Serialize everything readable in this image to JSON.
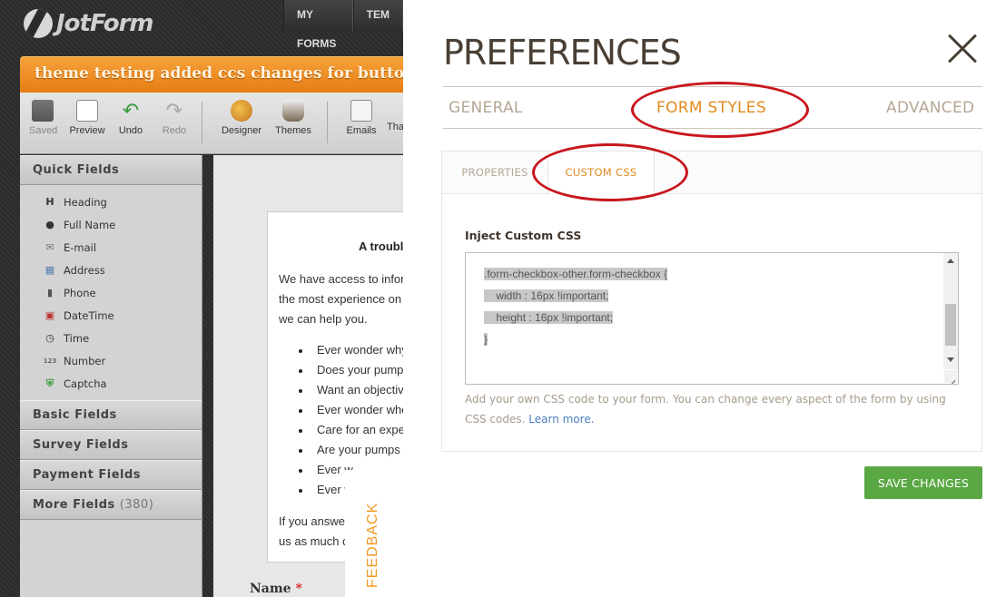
{
  "builder": {
    "logo_text": "JotForm",
    "top_nav": [
      "MY FORMS",
      "TEM"
    ],
    "form_title": "theme testing added ccs changes for buttons",
    "toolbar": [
      {
        "label": "Saved",
        "icon": "save-icon"
      },
      {
        "label": "Preview",
        "icon": "preview-icon"
      },
      {
        "label": "Undo",
        "icon": "undo-icon"
      },
      {
        "label": "Redo",
        "icon": "redo-icon"
      },
      {
        "label": "Designer",
        "icon": "palette-icon"
      },
      {
        "label": "Themes",
        "icon": "themes-icon"
      },
      {
        "label": "Emails",
        "icon": "email-icon"
      },
      {
        "label": "Tha",
        "icon": "thankyou-icon"
      }
    ],
    "quick_fields_title": "Quick Fields",
    "quick_fields": [
      "Heading",
      "Full Name",
      "E-mail",
      "Address",
      "Phone",
      "DateTime",
      "Time",
      "Number",
      "Captcha"
    ],
    "sections": [
      {
        "label": "Basic Fields",
        "count": ""
      },
      {
        "label": "Survey Fields",
        "count": ""
      },
      {
        "label": "Payment Fields",
        "count": ""
      },
      {
        "label": "More Fields",
        "count": "(380)"
      }
    ],
    "form_preview": {
      "title": "A trouble",
      "intro": [
        "We have access to informa",
        "the most experience on st",
        "we can help you."
      ],
      "bullets": [
        "Ever wonder why",
        "Does your pump s",
        "Want an objectiv",
        "Ever wonder whe",
        "Care for an expert",
        "Are your pumps b",
        "Ever w",
        "Ever w"
      ],
      "outro": [
        "If you answe",
        "us as much de"
      ],
      "name_label": "Name",
      "required_mark": "*"
    },
    "feedback_label": "FEEDBACK"
  },
  "preferences": {
    "title": "PREFERENCES",
    "tabs": [
      {
        "label": "GENERAL",
        "active": false
      },
      {
        "label": "FORM STYLES",
        "active": true
      },
      {
        "label": "ADVANCED",
        "active": false
      }
    ],
    "sub_tabs": [
      {
        "label": "PROPERTIES",
        "active": false
      },
      {
        "label": "CUSTOM CSS",
        "active": true
      }
    ],
    "inject_label": "Inject Custom CSS",
    "css_lines": [
      ".form-checkbox-other.form-checkbox {",
      "    width : 16px !important;",
      "    height : 16px !important;",
      "}"
    ],
    "help_text": "Add your own CSS code to your form. You can change every aspect of the form by using CSS codes.",
    "learn_more": "Learn more.",
    "save_label": "SAVE CHANGES"
  },
  "colors": {
    "accent_orange": "#e28a1e",
    "save_green": "#5aa844",
    "annotation_red": "#c8161d"
  }
}
